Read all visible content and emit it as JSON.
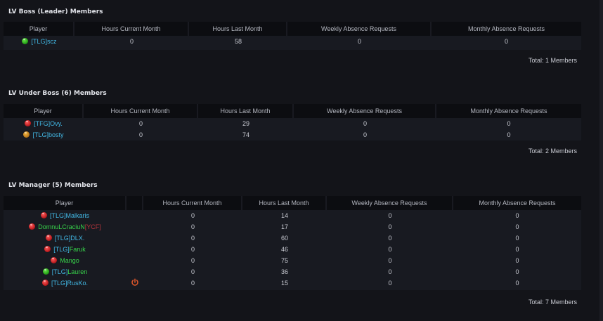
{
  "sections": [
    {
      "title": "LV Boss (Leader) Members",
      "headers": [
        "Player",
        "Hours Current Month",
        "Hours Last Month",
        "Weekly Absence Requests",
        "Monthly Absence Requests"
      ],
      "rows": [
        {
          "status": "green",
          "tag": "[TLG]",
          "name": "scz",
          "current": "0",
          "last": "58",
          "weekly": "0",
          "monthly": "0"
        }
      ],
      "total": "Total: 1 Members"
    },
    {
      "title": "LV Under Boss (6) Members",
      "headers": [
        "Player",
        "Hours Current Month",
        "Hours Last Month",
        "Weekly Absence Requests",
        "Monthly Absence Requests"
      ],
      "rows": [
        {
          "status": "red",
          "tag": "[TFG]",
          "name": "Ovy.",
          "current": "0",
          "last": "29",
          "weekly": "0",
          "monthly": "0"
        },
        {
          "status": "orange",
          "tag": "[TLG]",
          "name": "bosty",
          "current": "0",
          "last": "74",
          "weekly": "0",
          "monthly": "0"
        }
      ],
      "total": "Total: 2 Members"
    },
    {
      "title": "LV Manager (5) Members",
      "headers": [
        "Player",
        "Hours Current Month",
        "Hours Last Month",
        "Weekly Absence Requests",
        "Monthly Absence Requests"
      ],
      "rows": [
        {
          "status": "red",
          "tag": "[TLG]",
          "name": "Malkaris",
          "current": "0",
          "last": "14",
          "weekly": "0",
          "monthly": "0"
        },
        {
          "status": "red",
          "name": "DomnuLCraciuN",
          "suffix": "[YCF]",
          "current": "0",
          "last": "17",
          "weekly": "0",
          "monthly": "0"
        },
        {
          "status": "red",
          "tag": "[TLG]",
          "name": "DLX.",
          "current": "0",
          "last": "60",
          "weekly": "0",
          "monthly": "0"
        },
        {
          "status": "red",
          "tag": "[TLG]",
          "name": "Faruk",
          "current": "0",
          "last": "46",
          "weekly": "0",
          "monthly": "0"
        },
        {
          "status": "red",
          "name": "Mango",
          "current": "0",
          "last": "75",
          "weekly": "0",
          "monthly": "0"
        },
        {
          "status": "green",
          "tag": "[TLG]",
          "name": "Lauren",
          "current": "0",
          "last": "36",
          "weekly": "0",
          "monthly": "0"
        },
        {
          "status": "red",
          "tag": "[TLG]",
          "name": "RusKo.",
          "current": "0",
          "last": "15",
          "weekly": "0",
          "monthly": "0",
          "icon": "power-icon"
        }
      ],
      "total": "Total: 7 Members"
    }
  ],
  "colors": {
    "background": "#131419",
    "header_bg": "#0c0d11",
    "row_bg": "#181a21",
    "tag_cyan": "#42b9e6",
    "name_green": "#37d24a",
    "tag_red": "#b3343b",
    "power_icon": "#e0572b"
  }
}
